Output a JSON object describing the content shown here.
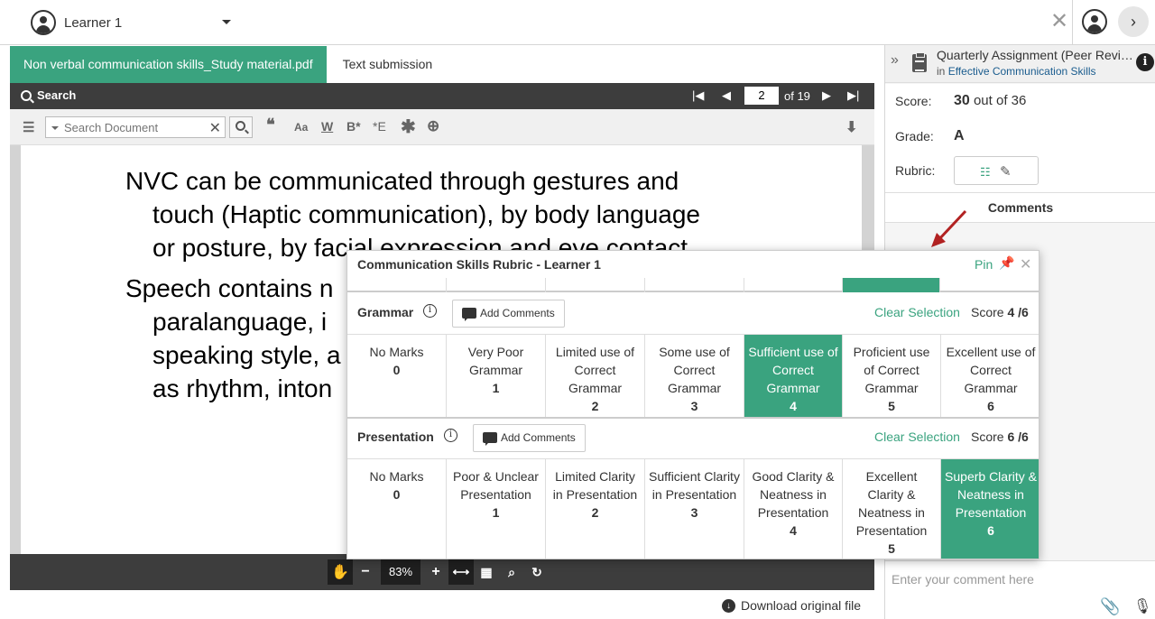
{
  "topbar": {
    "learner_name": "Learner 1",
    "close_symbol": "✕",
    "next_symbol": "›"
  },
  "tabs": [
    {
      "label": "Non verbal communication skills_Study material.pdf",
      "active": true
    },
    {
      "label": "Text submission",
      "active": false
    }
  ],
  "viewer": {
    "search_label": "Search",
    "current_page": "2",
    "page_of": "of 19",
    "search_placeholder": "Search Document",
    "zoom": "83%",
    "download_label": "Download original file"
  },
  "document": {
    "para1_line1": "NVC can be communicated through gestures and",
    "para1_line2": "touch (Haptic communication), by body language",
    "para1_line3": "or posture, by facial expression and eye contact.",
    "para2_line1": "Speech contains n",
    "para2_line2": "paralanguage, i",
    "para2_line3": "speaking style, a",
    "para2_line4": "as rhythm, inton"
  },
  "assignment": {
    "title": "Quarterly Assignment (Peer Review)",
    "in_prefix": "in",
    "course": "Effective Communication Skills",
    "score_label": "Score:",
    "score_value": "30",
    "score_suffix": "out of 36",
    "grade_label": "Grade:",
    "grade_value": "A",
    "rubric_label": "Rubric:",
    "comments_label": "Comments",
    "comment_placeholder": "Enter your comment here"
  },
  "rubric_popup": {
    "title": "Communication Skills Rubric - Learner 1",
    "pin_label": "Pin",
    "criteria": [
      {
        "name": "Grammar",
        "add_comments": "Add Comments",
        "clear": "Clear Selection",
        "score_label": "Score",
        "score_value": "4 /6",
        "levels": [
          {
            "label": "No Marks",
            "points": "0",
            "selected": false
          },
          {
            "label": "Very Poor Grammar",
            "points": "1",
            "selected": false
          },
          {
            "label": "Limited use of Correct Grammar",
            "points": "2",
            "selected": false
          },
          {
            "label": "Some use of Correct Grammar",
            "points": "3",
            "selected": false
          },
          {
            "label": "Sufficient use of Correct Grammar",
            "points": "4",
            "selected": true
          },
          {
            "label": "Proficient use of Correct Grammar",
            "points": "5",
            "selected": false
          },
          {
            "label": "Excellent use of Correct Grammar",
            "points": "6",
            "selected": false
          }
        ]
      },
      {
        "name": "Presentation",
        "add_comments": "Add Comments",
        "clear": "Clear Selection",
        "score_label": "Score",
        "score_value": "6 /6",
        "levels": [
          {
            "label": "No Marks",
            "points": "0",
            "selected": false
          },
          {
            "label": "Poor & Unclear Presentation",
            "points": "1",
            "selected": false
          },
          {
            "label": "Limited Clarity in Presentation",
            "points": "2",
            "selected": false
          },
          {
            "label": "Sufficient Clarity in Presentation",
            "points": "3",
            "selected": false
          },
          {
            "label": "Good Clarity & Neatness in Presentation",
            "points": "4",
            "selected": false
          },
          {
            "label": "Excellent Clarity & Neatness in Presentation",
            "points": "5",
            "selected": false
          },
          {
            "label": "Superb Clarity & Neatness in Presentation",
            "points": "6",
            "selected": true
          }
        ]
      }
    ]
  },
  "colors": {
    "accent": "#3aa37f",
    "toolbar_dark": "#3d3d3d",
    "annotation_arrow": "#b22222"
  },
  "icons": {
    "list": "list-icon",
    "quote": "quote-icon",
    "font_size": "font-size-icon",
    "word": "word-icon",
    "bold": "bold-icon",
    "emphasis": "emphasis-icon",
    "asterisk": "asterisk-icon",
    "target": "target-icon",
    "download": "download-icon"
  }
}
